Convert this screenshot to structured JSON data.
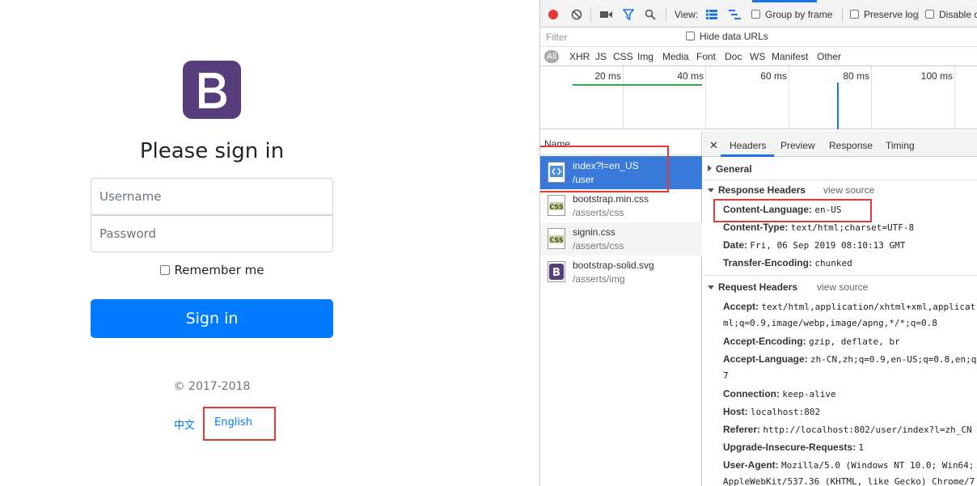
{
  "signin": {
    "logo_letter": "B",
    "title": "Please sign in",
    "username_placeholder": "Username",
    "password_placeholder": "Password",
    "remember_label": "Remember me",
    "submit_label": "Sign in",
    "copyright": "© 2017-2018",
    "lang_zh": "中文",
    "lang_en": "English",
    "brand_color": "#563d7c",
    "button_color": "#007bff"
  },
  "devtools": {
    "toolbar": {
      "view_label": "View:",
      "group_by_frame": "Group by frame",
      "preserve_log": "Preserve log",
      "disable_cache": "Disable cache"
    },
    "filter": {
      "placeholder": "Filter",
      "hide_data_urls": "Hide data URLs"
    },
    "types": [
      "All",
      "XHR",
      "JS",
      "CSS",
      "Img",
      "Media",
      "Font",
      "Doc",
      "WS",
      "Manifest",
      "Other"
    ],
    "overview_ticks": [
      "20 ms",
      "40 ms",
      "60 ms",
      "80 ms",
      "100 ms"
    ],
    "name_column": "Name",
    "requests": [
      {
        "name": "index?l=en_US",
        "path": "/user",
        "icon": "document-icon",
        "selected": true
      },
      {
        "name": "bootstrap.min.css",
        "path": "/asserts/css",
        "icon": "css-file-icon"
      },
      {
        "name": "signin.css",
        "path": "/asserts/css",
        "icon": "css-file-icon"
      },
      {
        "name": "bootstrap-solid.svg",
        "path": "/asserts/img",
        "icon": "image-file-icon"
      }
    ],
    "detail_tabs": [
      "Headers",
      "Preview",
      "Response",
      "Timing"
    ],
    "general_label": "General",
    "response_headers_label": "Response Headers",
    "request_headers_label": "Request Headers",
    "view_source": "view source",
    "response_headers": [
      {
        "key": "Content-Language:",
        "value": "en-US"
      },
      {
        "key": "Content-Type:",
        "value": "text/html;charset=UTF-8"
      },
      {
        "key": "Date:",
        "value": "Fri, 06 Sep 2019 08:10:13 GMT"
      },
      {
        "key": "Transfer-Encoding:",
        "value": "chunked"
      }
    ],
    "request_headers": [
      {
        "key": "Accept:",
        "value": "text/html,application/xhtml+xml,applicat",
        "cont": "ml;q=0.9,image/webp,image/apng,*/*;q=0.8"
      },
      {
        "key": "Accept-Encoding:",
        "value": "gzip, deflate, br"
      },
      {
        "key": "Accept-Language:",
        "value": "zh-CN,zh;q=0.9,en-US;q=0.8,en;q",
        "cont": "7"
      },
      {
        "key": "Connection:",
        "value": "keep-alive"
      },
      {
        "key": "Host:",
        "value": "localhost:802"
      },
      {
        "key": "Referer:",
        "value": "http://localhost:802/user/index?l=zh_CN"
      },
      {
        "key": "Upgrade-Insecure-Requests:",
        "value": "1"
      },
      {
        "key": "User-Agent:",
        "value": "Mozilla/5.0 (Windows NT 10.0; Win64;",
        "cont": "AppleWebKit/537.36 (KHTML, like Gecko) Chrome/7"
      }
    ]
  }
}
